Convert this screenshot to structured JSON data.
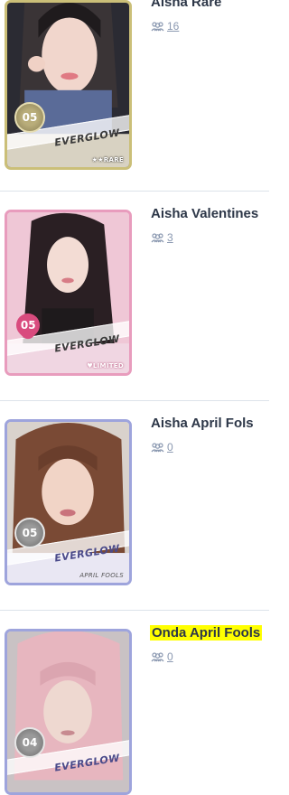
{
  "cards": [
    {
      "title": "Aisha Rare",
      "count": "16",
      "card_number": "05",
      "brand": "EVERGLOW",
      "rarity": "★★RARE",
      "frame_color": "#c9b96a",
      "highlighted": false,
      "icon": "people-icon"
    },
    {
      "title": "Aisha Valentines",
      "count": "3",
      "card_number": "05",
      "brand": "EVERGLOW",
      "rarity": "♥LIMITED",
      "frame_color": "#e58fb4",
      "highlighted": false,
      "icon": "people-icon"
    },
    {
      "title": "Aisha April Fols",
      "count": "0",
      "card_number": "05",
      "brand": "EVERGLOW",
      "rarity": "APRIL FOOLS",
      "frame_color": "#9aa0d8",
      "highlighted": false,
      "icon": "people-icon"
    },
    {
      "title": "Onda April Fools",
      "count": "0",
      "card_number": "04",
      "brand": "EVERGLOW",
      "rarity": "",
      "frame_color": "#9aa0d8",
      "highlighted": true,
      "icon": "people-icon"
    }
  ]
}
